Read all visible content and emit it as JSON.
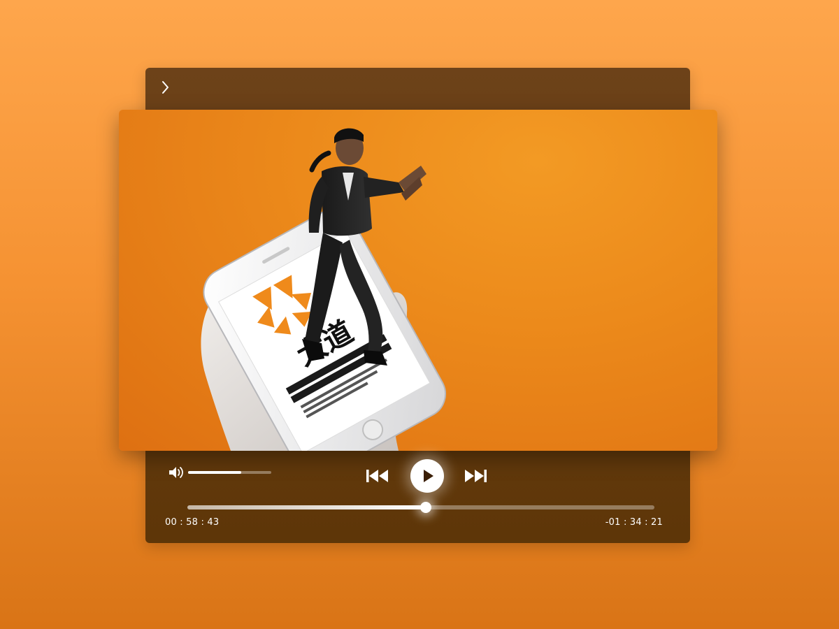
{
  "colors": {
    "background_top": "#fea64c",
    "background_bottom": "#d97416",
    "panel": "#5e3608",
    "video_bg": "#ec8a1b",
    "accent": "#ffffff"
  },
  "icons": {
    "expand": "chevron-right-icon",
    "volume": "speaker-icon",
    "previous": "skip-previous-icon",
    "play": "play-icon",
    "next": "skip-next-icon"
  },
  "video": {
    "screen_logo_text": "大道"
  },
  "player": {
    "volume_level": 0.64,
    "progress": 0.51,
    "time_elapsed": "00 : 58 : 43",
    "time_remaining": "-01 : 34 : 21"
  }
}
